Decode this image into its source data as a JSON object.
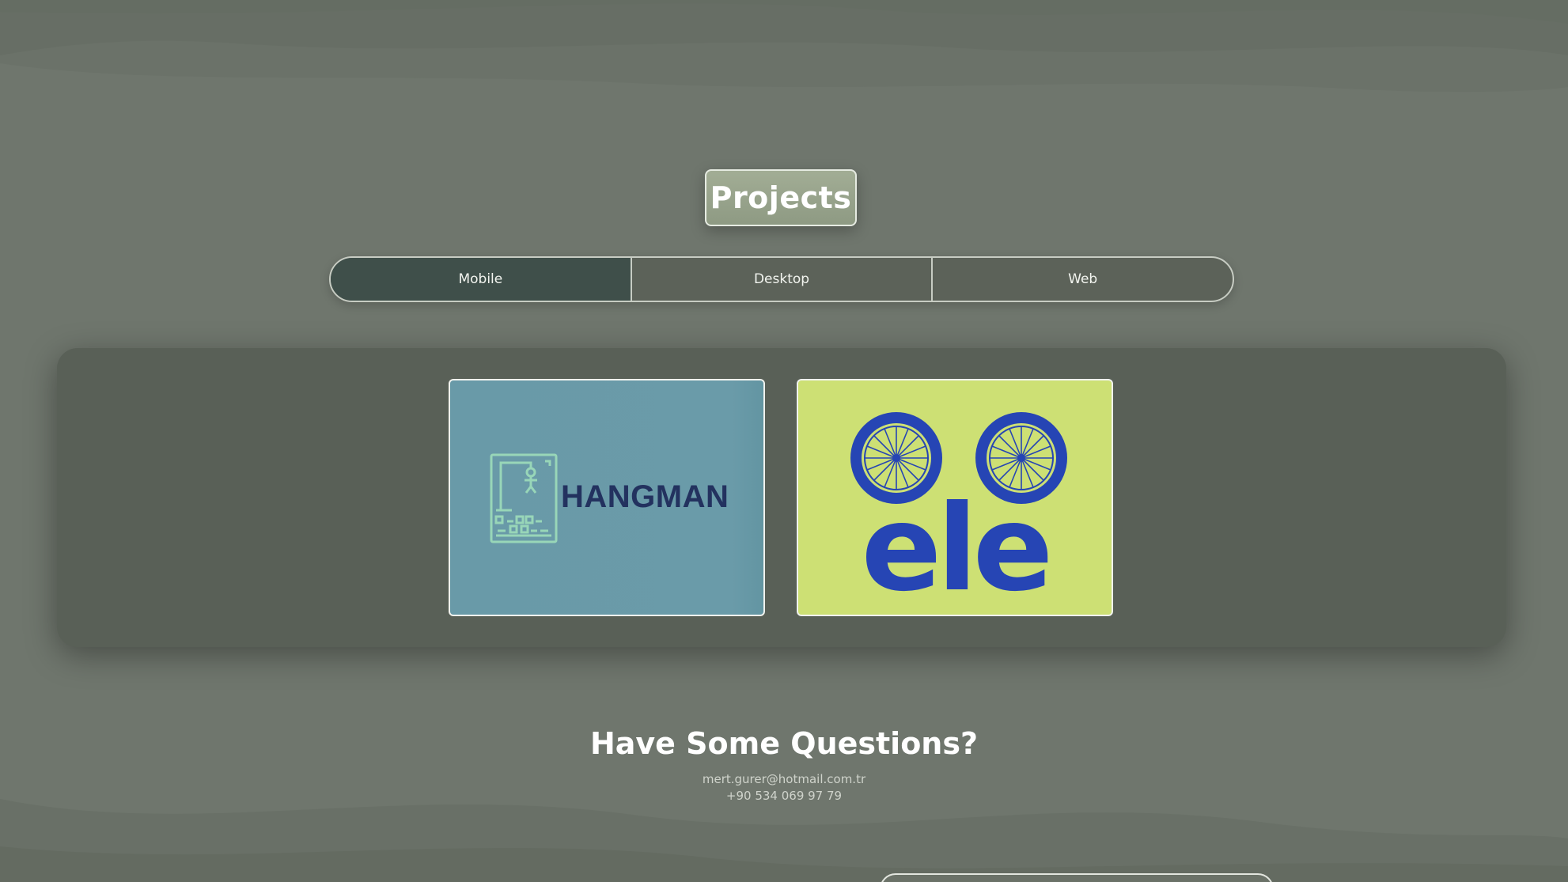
{
  "header": {
    "title": "Projects"
  },
  "tabs": [
    {
      "label": "Mobile",
      "active": true
    },
    {
      "label": "Desktop",
      "active": false
    },
    {
      "label": "Web",
      "active": false
    }
  ],
  "projects": [
    {
      "name": "HANGMAN",
      "icon": "hangman-gallows-icon"
    },
    {
      "name": "ele",
      "icon": "bicycle-wheels-logo"
    }
  ],
  "contact": {
    "title": "Have Some Questions?",
    "email": "mert.gurer@hotmail.com.tr",
    "phone": "+90 534 069 97 79"
  },
  "colors": {
    "background": "#6f766d",
    "panel": "#596057",
    "active_tab": "#3f4f4a",
    "title_badge": "#97a38c",
    "hangman_card": "#699aa8",
    "ele_card": "#cde074",
    "ele_blue": "#2645b4"
  }
}
